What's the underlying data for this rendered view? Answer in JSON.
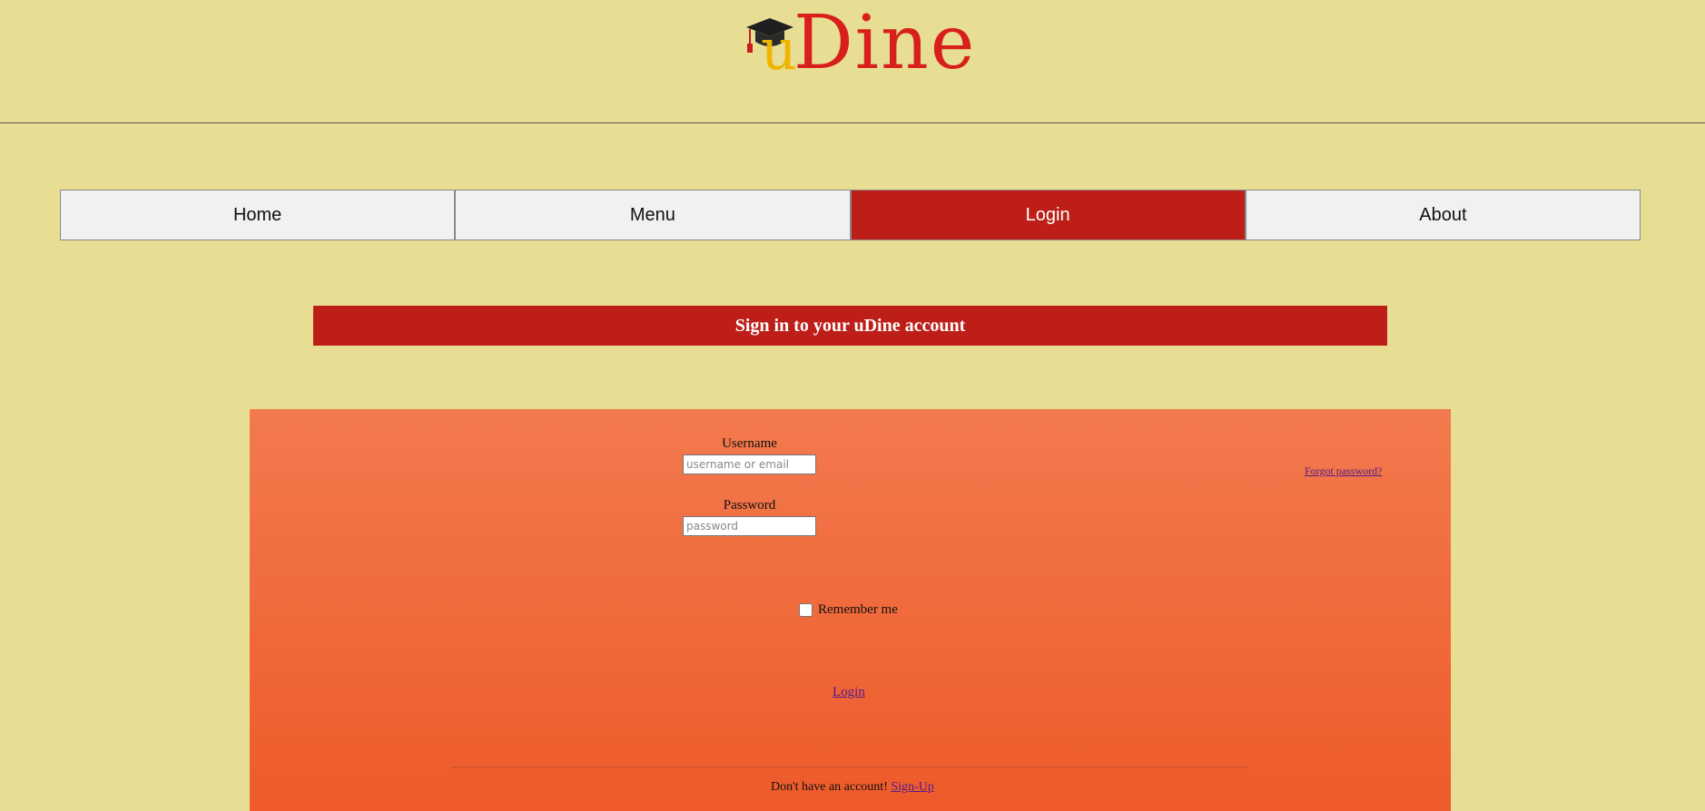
{
  "brand": {
    "logo_u": "u",
    "logo_dine": "Dine",
    "cap_icon": "graduation-cap-icon"
  },
  "nav": {
    "items": [
      {
        "label": "Home"
      },
      {
        "label": "Menu"
      },
      {
        "label": "Login"
      },
      {
        "label": "About"
      }
    ],
    "active": "Login"
  },
  "banner": {
    "title": "Sign in to your uDine account"
  },
  "form": {
    "username_label": "Username",
    "username_placeholder": "username or email",
    "username_value": "",
    "password_label": "Password",
    "password_placeholder": "password",
    "password_value": "",
    "forgot_link": "Forgot password?",
    "remember_label": "Remember me",
    "remember_checked": false,
    "login_link": "Login",
    "signup_prompt": "Don't have an account!",
    "signup_link": "Sign-Up"
  },
  "colors": {
    "page_bg": "#e7de94",
    "accent_red": "#be1e18",
    "panel_top": "#f27a4e",
    "panel_bottom": "#ee5a2a",
    "logo_yellow": "#f0b400",
    "logo_red": "#d8201a"
  }
}
